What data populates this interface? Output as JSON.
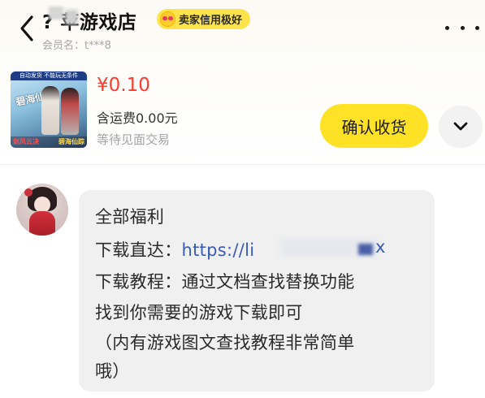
{
  "header": {
    "back_icon": "chevron-left-icon",
    "shop_title": "? 苹游戏店",
    "rating_badge": "卖家信用极好",
    "badge_icon": "heart-eyes-emoji-icon",
    "member_name": "会员名：t***8",
    "more_icon": "ellipsis-icon"
  },
  "order": {
    "thumbnail_alt": "剑风云决 碧海仙踪 game cover",
    "thumb_top_text": "自动发货 不能玩无条件",
    "thumb_title": "碧海仙踪",
    "thumb_bottom_left": "剑风云决",
    "thumb_bottom_right": "碧海仙踪",
    "price": "¥0.10",
    "shipping": "含运费0.00元",
    "status": "等待见面交易",
    "confirm_button": "确认收货",
    "expand_icon": "chevron-down-icon"
  },
  "message": {
    "avatar_icon": "user-avatar",
    "line1": "全部福利",
    "line2_prefix": "下载直达：",
    "line2_link": "https://li",
    "line2_link_end": "x",
    "line3": "下载教程：通过文档查找替换功能",
    "line4": "找到你需要的游戏下载即可",
    "line5": "（内有游戏图文查找教程非常简单",
    "line6": "哦）"
  },
  "colors": {
    "accent_yellow": "#ffe226",
    "price_red": "#ff3b2f",
    "link_blue": "#3a5bb8",
    "bubble_bg": "#f0f0f0"
  }
}
